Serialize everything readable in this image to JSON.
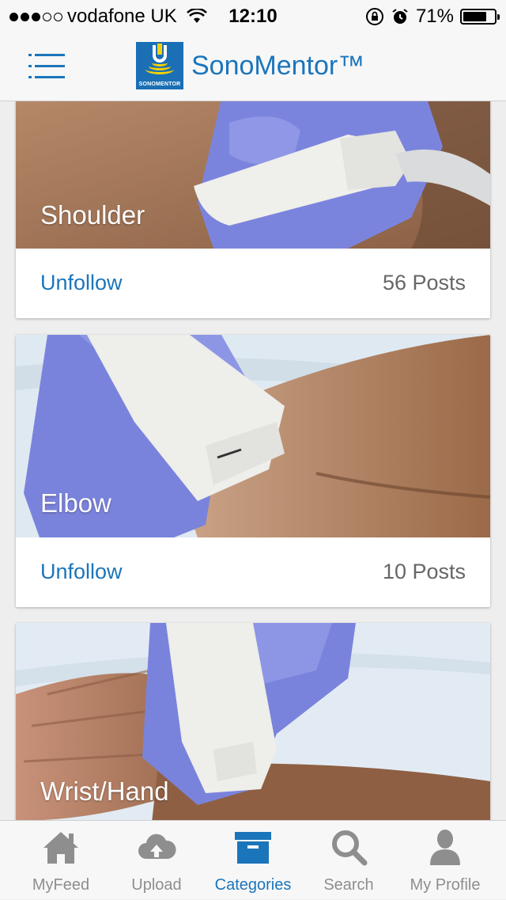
{
  "status_bar": {
    "carrier": "vodafone UK",
    "time": "12:10",
    "battery": "71%",
    "signal_bars_filled": 3,
    "signal_bars_total": 5
  },
  "header": {
    "app_title": "SonoMentor™",
    "logo_text": "SONOMENTOR",
    "menu_icon": "hamburger-menu-icon"
  },
  "categories": [
    {
      "name": "Shoulder",
      "follow_label": "Unfollow",
      "posts": "56 Posts"
    },
    {
      "name": "Elbow",
      "follow_label": "Unfollow",
      "posts": "10 Posts"
    },
    {
      "name": "Wrist/Hand"
    }
  ],
  "tabs": [
    {
      "label": "MyFeed",
      "icon": "home-icon",
      "active": false
    },
    {
      "label": "Upload",
      "icon": "cloud-upload-icon",
      "active": false
    },
    {
      "label": "Categories",
      "icon": "archive-box-icon",
      "active": true
    },
    {
      "label": "Search",
      "icon": "search-icon",
      "active": false
    },
    {
      "label": "My Profile",
      "icon": "user-icon",
      "active": false
    }
  ],
  "colors": {
    "accent": "#1b75bb",
    "tab_inactive": "#8e8e8e",
    "glove": "#7e87e0",
    "skin": "#a57b5c",
    "probe": "#eeeeea"
  }
}
